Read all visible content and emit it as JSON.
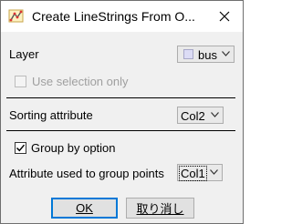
{
  "window": {
    "title": "Create LineStrings From O..."
  },
  "layer": {
    "label": "Layer",
    "value": "bus"
  },
  "use_selection": {
    "label": "Use selection only",
    "checked": false,
    "enabled": false
  },
  "sorting": {
    "label": "Sorting attribute",
    "value": "Col2"
  },
  "group_by": {
    "label": "Group by option",
    "checked": true
  },
  "group_attribute": {
    "label": "Attribute used to group points",
    "value": "Col1"
  },
  "buttons": {
    "ok_label": "OK",
    "cancel_label": "取り消し"
  }
}
